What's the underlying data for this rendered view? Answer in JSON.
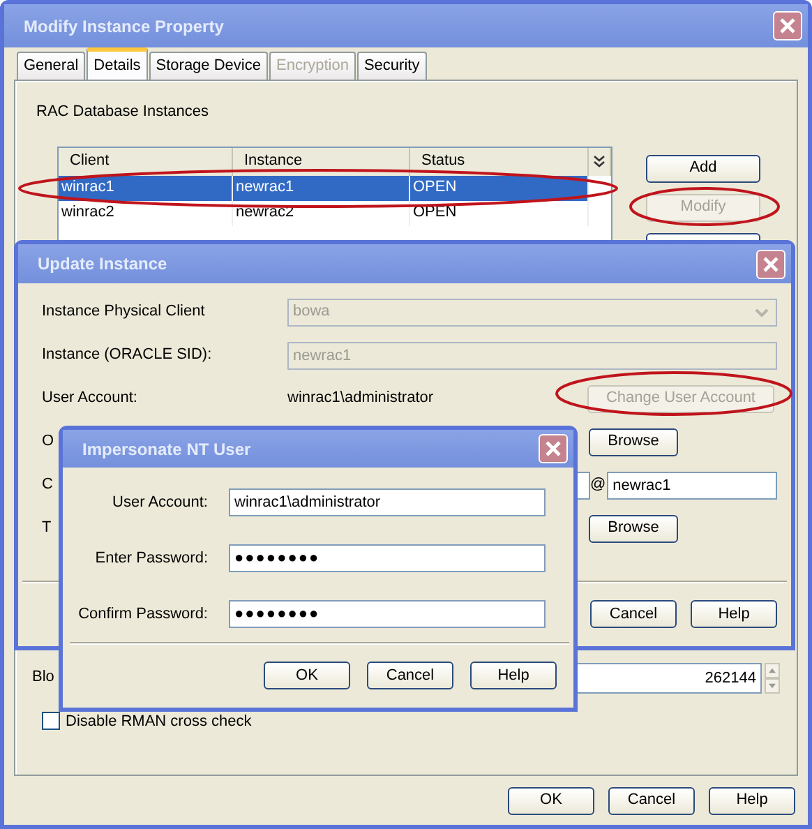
{
  "main_window": {
    "title": "Modify Instance Property",
    "tabs": [
      {
        "label": "General",
        "selected": false,
        "disabled": false
      },
      {
        "label": "Details",
        "selected": true,
        "disabled": false
      },
      {
        "label": "Storage Device",
        "selected": false,
        "disabled": false
      },
      {
        "label": "Encryption",
        "selected": false,
        "disabled": true
      },
      {
        "label": "Security",
        "selected": false,
        "disabled": false
      }
    ],
    "section_label": "RAC Database Instances",
    "table": {
      "columns": [
        "Client",
        "Instance",
        "Status"
      ],
      "rows": [
        {
          "cells": [
            "winrac1",
            "newrac1",
            "OPEN"
          ],
          "selected": true
        },
        {
          "cells": [
            "winrac2",
            "newrac2",
            "OPEN"
          ],
          "selected": false
        }
      ]
    },
    "side_buttons": [
      {
        "label": "Add",
        "disabled": false
      },
      {
        "label": "Modify",
        "disabled": true
      }
    ],
    "block_label": "Blo",
    "block_value": "262144",
    "checkbox": {
      "label": "Disable RMAN cross check",
      "checked": false
    },
    "buttons": [
      "OK",
      "Cancel",
      "Help"
    ]
  },
  "update_instance": {
    "title": "Update Instance",
    "rows": [
      {
        "kind": "select",
        "label": "Instance Physical Client",
        "value": "bowa",
        "disabled": true
      },
      {
        "kind": "text",
        "label": "Instance (ORACLE SID):",
        "value": "newrac1",
        "disabled": true
      },
      {
        "kind": "account",
        "label": "User Account:",
        "value": "winrac1\\administrator",
        "button": "Change User Account",
        "disabled": true
      },
      {
        "kind": "browse",
        "label": "O",
        "button": "Browse"
      },
      {
        "kind": "connect",
        "label": "C",
        "separator": "@",
        "value": "newrac1"
      },
      {
        "kind": "browse",
        "label": "T",
        "button": "Browse"
      }
    ],
    "buttons": [
      "Cancel",
      "Help"
    ]
  },
  "impersonate": {
    "title": "Impersonate NT User",
    "fields": [
      {
        "kind": "text",
        "label": "User Account:",
        "value": "winrac1\\administrator"
      },
      {
        "kind": "password",
        "label": "Enter Password:",
        "value": "●●●●●●●●"
      },
      {
        "kind": "password",
        "label": "Confirm Password:",
        "value": "●●●●●●●●"
      }
    ],
    "buttons": [
      "OK",
      "Cancel",
      "Help"
    ]
  },
  "callouts": [
    {
      "kind": "ellipse"
    },
    {
      "kind": "ellipse"
    },
    {
      "kind": "ellipse"
    }
  ]
}
